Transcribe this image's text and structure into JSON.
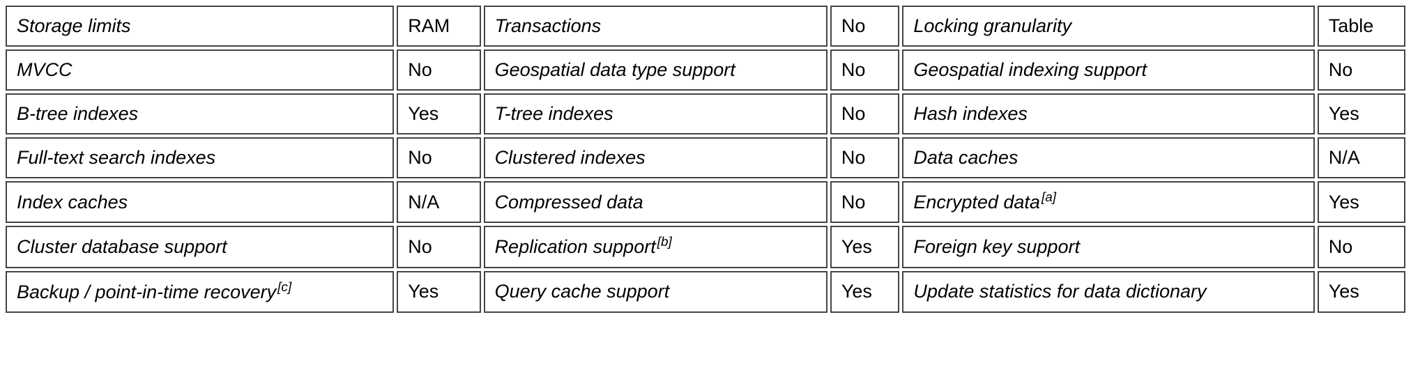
{
  "rows": [
    [
      {
        "label": "Storage limits",
        "value": "RAM"
      },
      {
        "label": "Transactions",
        "value": "No"
      },
      {
        "label": "Locking granularity",
        "value": "Table"
      }
    ],
    [
      {
        "label": "MVCC",
        "value": "No"
      },
      {
        "label": "Geospatial data type support",
        "value": "No"
      },
      {
        "label": "Geospatial indexing support",
        "value": "No"
      }
    ],
    [
      {
        "label": "B-tree indexes",
        "value": "Yes"
      },
      {
        "label": "T-tree indexes",
        "value": "No"
      },
      {
        "label": "Hash indexes",
        "value": "Yes"
      }
    ],
    [
      {
        "label": "Full-text search indexes",
        "value": "No"
      },
      {
        "label": "Clustered indexes",
        "value": "No"
      },
      {
        "label": "Data caches",
        "value": "N/A"
      }
    ],
    [
      {
        "label": "Index caches",
        "value": "N/A"
      },
      {
        "label": "Compressed data",
        "value": "No"
      },
      {
        "label": "Encrypted data",
        "footnote": "[a]",
        "value": "Yes"
      }
    ],
    [
      {
        "label": "Cluster database support",
        "value": "No"
      },
      {
        "label": "Replication support",
        "footnote": "[b]",
        "value": "Yes"
      },
      {
        "label": "Foreign key support",
        "value": "No"
      }
    ],
    [
      {
        "label": "Backup / point-in-time recovery",
        "footnote": "[c]",
        "value": "Yes"
      },
      {
        "label": "Query cache support",
        "value": "Yes"
      },
      {
        "label": "Update statistics for data dictionary",
        "value": "Yes"
      }
    ]
  ]
}
